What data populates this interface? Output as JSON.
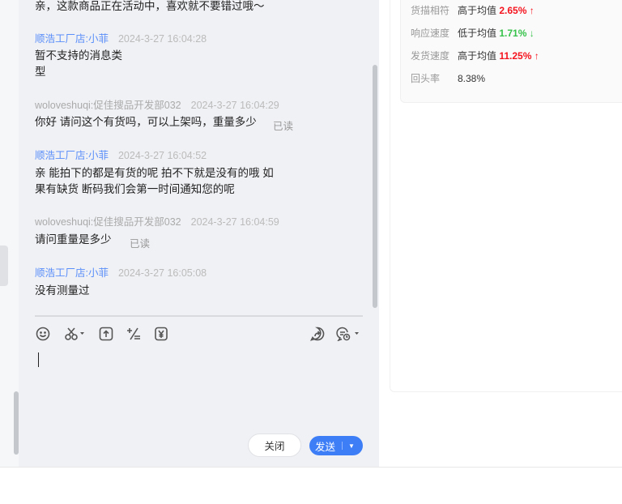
{
  "messages": [
    {
      "text": "亲，这款商品正在活动中，喜欢就不要错过哦～"
    },
    {
      "sender": "顺浩工厂店:小菲",
      "time": "2024-3-27 16:04:28",
      "lines": [
        "暂不支持的消息类",
        "型"
      ]
    },
    {
      "sender": "woloveshuqi:促佳搜品开发部032",
      "time": "2024-3-27 16:04:29",
      "lines": [
        "你好 请问这个有货吗，可以上架吗，重量多少"
      ],
      "status": "已读"
    },
    {
      "sender": "顺浩工厂店:小菲",
      "time": "2024-3-27 16:04:52",
      "lines": [
        "亲 能拍下的都是有货的呢 拍不下就是没有的哦 如",
        "果有缺货 断码我们会第一时间通知您的呢"
      ]
    },
    {
      "sender": "woloveshuqi:促佳搜品开发部032",
      "time": "2024-3-27 16:04:59",
      "lines": [
        "请问重量是多少"
      ],
      "status": "已读"
    },
    {
      "sender": "顺浩工厂店:小菲",
      "time": "2024-3-27 16:05:08",
      "lines": [
        "没有测量过"
      ]
    }
  ],
  "toolbar": {
    "icons": [
      "emoji-icon",
      "scissors-icon",
      "upload-icon",
      "plus-minus-icon",
      "yuan-coupon-icon",
      "forward-icon",
      "quick-reply-icon"
    ]
  },
  "buttons": {
    "close": "关闭",
    "send": "发送"
  },
  "stats": [
    {
      "label": "货描相符",
      "compare": "高于均值",
      "value": "2.65%",
      "arrow": "↑",
      "trend": "up"
    },
    {
      "label": "响应速度",
      "compare": "低于均值",
      "value": "1.71%",
      "arrow": "↓",
      "trend": "down"
    },
    {
      "label": "发货速度",
      "compare": "高于均值",
      "value": "11.25%",
      "arrow": "↑",
      "trend": "up"
    },
    {
      "label": "回头率",
      "compare": "8.38%"
    }
  ],
  "colors": {
    "accent": "#3d7ef7",
    "up": "#f5141e",
    "down": "#36c24a",
    "shop_name": "#5b8ff9"
  }
}
